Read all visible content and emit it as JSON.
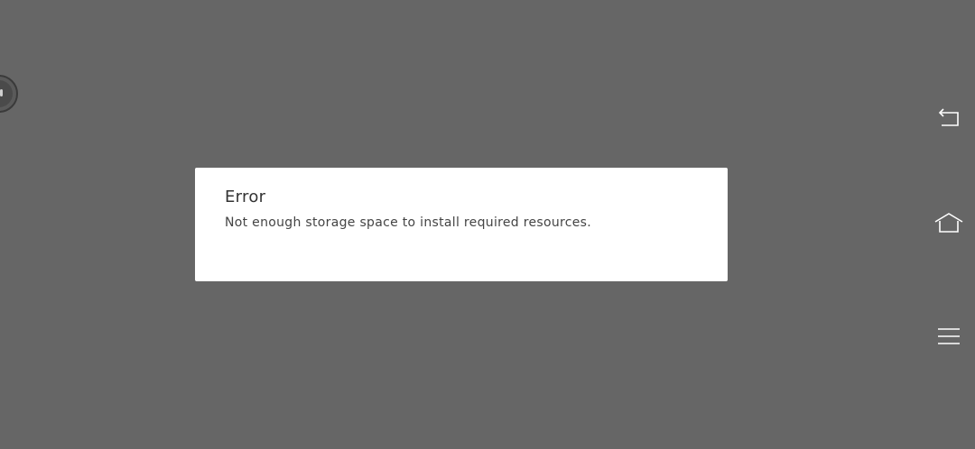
{
  "dialog": {
    "title": "Error",
    "message": "Not enough storage space to install required resources."
  },
  "nav": {
    "back_icon": "back-icon",
    "home_icon": "home-icon",
    "menu_icon": "menu-icon"
  },
  "floating_button_icon": "pause-icon",
  "colors": {
    "background": "#666666",
    "dialog_bg": "#ffffff",
    "text": "#333333",
    "icon": "#ffffff"
  }
}
